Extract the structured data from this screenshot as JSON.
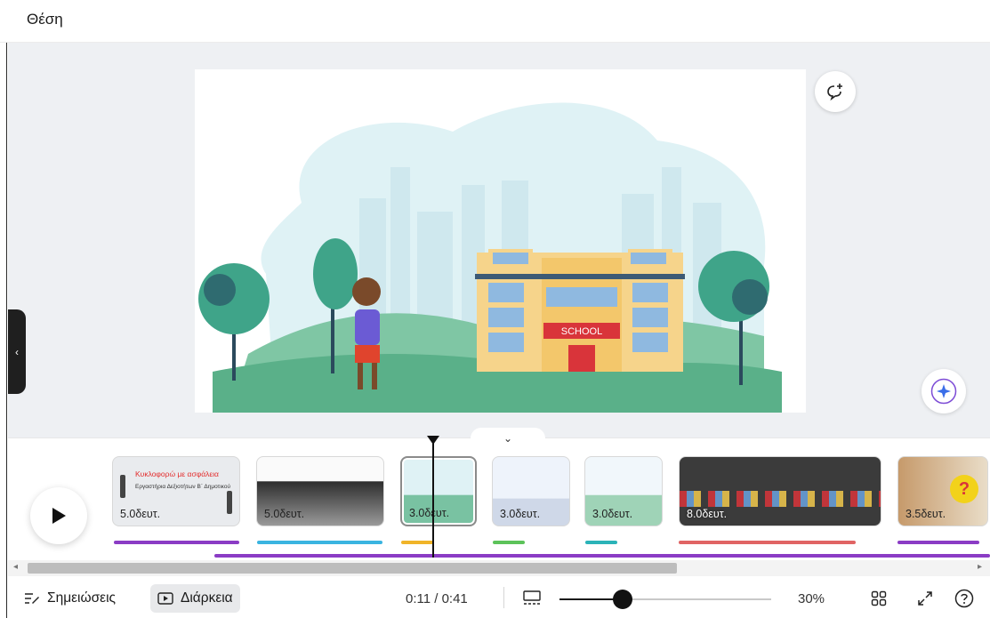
{
  "header": {
    "title": "Θέση"
  },
  "clips": [
    {
      "duration": "5.0δευτ.",
      "title_text": "Κυκλοφορώ με ασφάλεια",
      "subtitle_text": "Εργαστήρια Δεξιοτήτων Β΄ Δημοτικού",
      "bar_color": "#8b3cc5"
    },
    {
      "duration": "5.0δευτ.",
      "bar_color": "#3ab4e0"
    },
    {
      "duration": "3.0δευτ.",
      "bar_color": "#f0b429"
    },
    {
      "duration": "3.0δευτ.",
      "bar_color": "#5cc35a"
    },
    {
      "duration": "3.0δευτ.",
      "bar_color": "#2bb3b8"
    },
    {
      "duration": "8.0δευτ.",
      "bar_color": "#e06464"
    },
    {
      "duration": "3.5δευτ.",
      "bar_color": "#8b3cc5"
    }
  ],
  "slide": {
    "building_sign": "SCHOOL"
  },
  "bottombar": {
    "notes_label": "Σημειώσεις",
    "duration_label": "Διάρκεια",
    "time": "0:11 / 0:41",
    "zoom": "30%",
    "zoom_level": 0.3
  },
  "colors": {
    "accent": "#8b3cc5",
    "slide_bg": "#ffffff",
    "canvas_bg": "#eef0f3"
  }
}
